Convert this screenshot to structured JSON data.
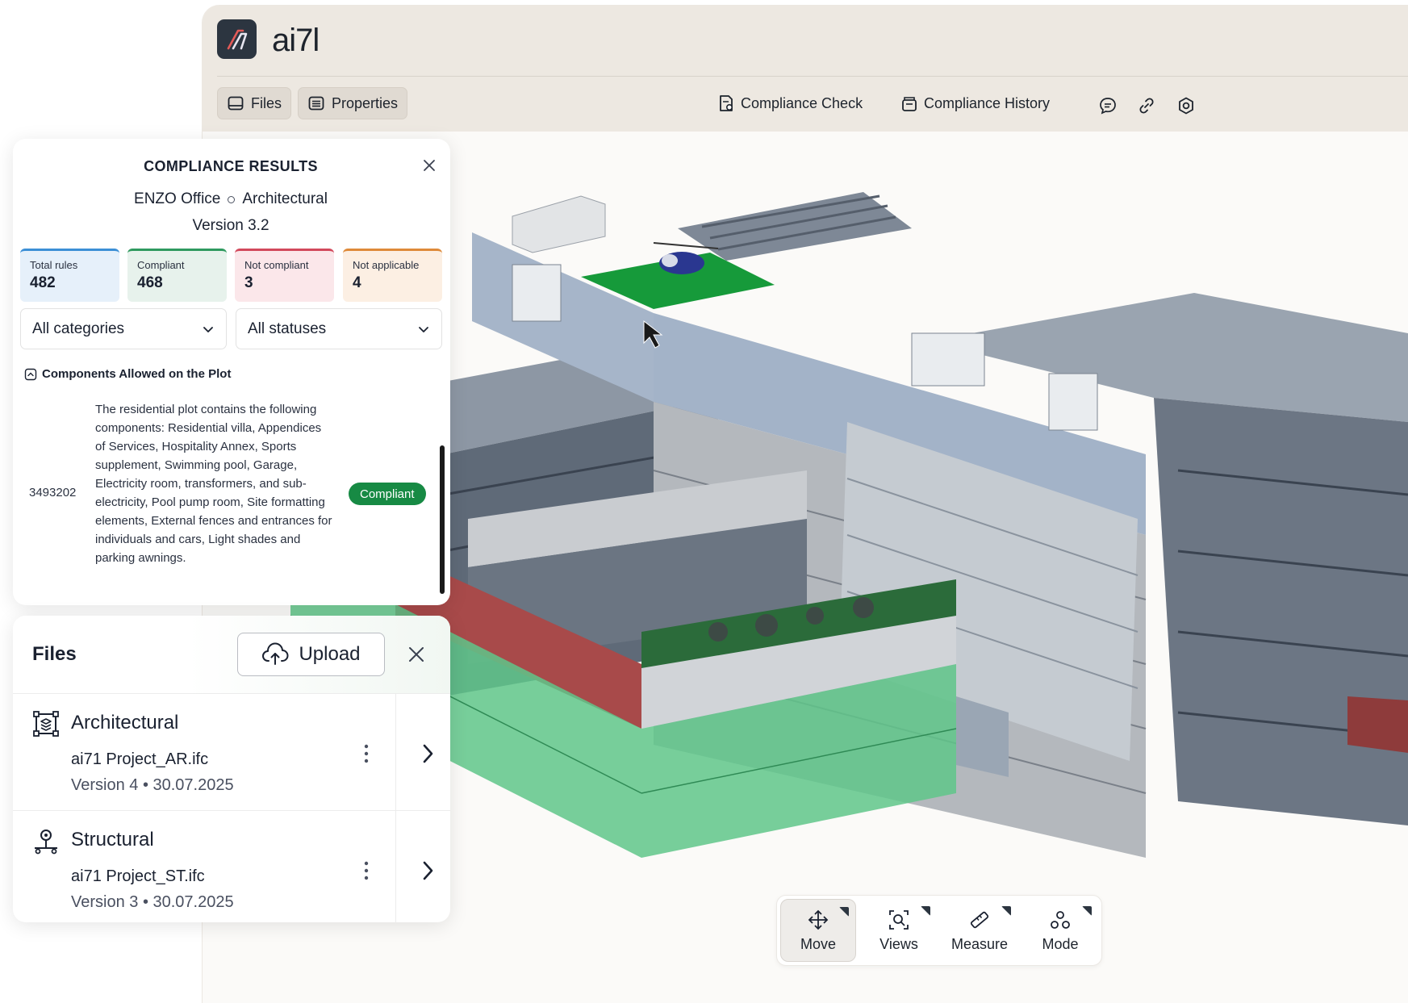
{
  "app": {
    "logo_text": "ai7l"
  },
  "topbar": {
    "files_label": "Files",
    "properties_label": "Properties",
    "compliance_check_label": "Compliance Check",
    "compliance_history_label": "Compliance History"
  },
  "compliance": {
    "title": "COMPLIANCE RESULTS",
    "project": "ENZO Office",
    "discipline": "Architectural",
    "version": "Version 3.2",
    "stats": [
      {
        "label": "Total rules",
        "value": "482"
      },
      {
        "label": "Compliant",
        "value": "468"
      },
      {
        "label": "Not compliant",
        "value": "3"
      },
      {
        "label": "Not applicable",
        "value": "4"
      }
    ],
    "filters": {
      "category": "All categories",
      "status": "All statuses"
    },
    "group_title": "Components Allowed on the Plot",
    "rule": {
      "id": "3493202",
      "text": "The residential plot contains the following components: Residential villa, Appendices of Services, Hospitality Annex, Sports supplement, Swimming pool, Garage, Electricity room, transformers, and sub-electricity, Pool pump room, Site formatting elements, External fences and entrances for individuals and cars, Light shades and parking awnings.",
      "status": "Compliant"
    }
  },
  "files_panel": {
    "title": "Files",
    "upload_label": "Upload",
    "items": [
      {
        "discipline": "Architectural",
        "filename": "ai71 Project_AR.ifc",
        "meta": "Version 4 • 30.07.2025"
      },
      {
        "discipline": "Structural",
        "filename": "ai71 Project_ST.ifc",
        "meta": "Version 3 • 30.07.2025"
      }
    ]
  },
  "toolbar": {
    "tools": [
      {
        "label": "Move",
        "icon": "move-icon",
        "active": true
      },
      {
        "label": "Views",
        "icon": "views-icon",
        "active": false
      },
      {
        "label": "Measure",
        "icon": "measure-icon",
        "active": false
      },
      {
        "label": "Mode",
        "icon": "mode-icon",
        "active": false
      }
    ]
  },
  "colors": {
    "brand_dark": "#2c3540",
    "compliant_green": "#178a44",
    "highlight_green": "#5fc58a",
    "heli_pad_green": "#169a3a"
  }
}
